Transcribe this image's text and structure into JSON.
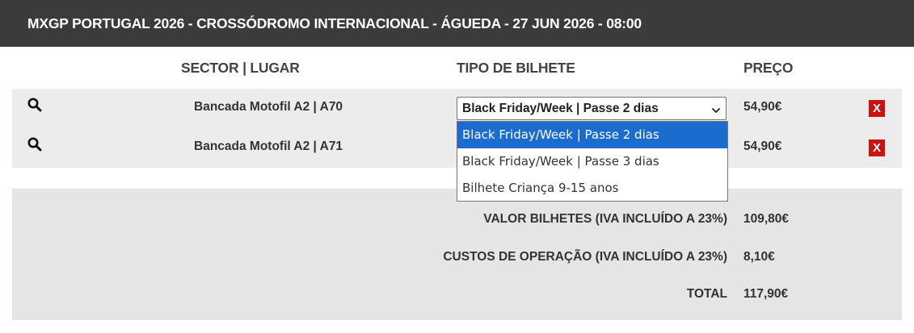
{
  "header": {
    "title": "MXGP PORTUGAL 2026 - CROSSÓDROMO INTERNACIONAL - ÁGUEDA - 27 JUN 2026 - 08:00"
  },
  "columns": {
    "sector": "SECTOR | LUGAR",
    "ticket_type": "TIPO DE BILHETE",
    "price": "PREÇO"
  },
  "rows": [
    {
      "seat": "Bancada Motofil A2 | A70",
      "ticket_type": "Black Friday/Week | Passe 2 dias",
      "price": "54,90€",
      "delete": "X"
    },
    {
      "seat": "Bancada Motofil A2 | A71",
      "ticket_type": "Black Friday/Week | Passe 2 dias",
      "price": "54,90€",
      "delete": "X"
    }
  ],
  "dropdown": {
    "options": [
      "Black Friday/Week | Passe 2 dias",
      "Black Friday/Week | Passe 3 dias",
      "Bilhete Criança 9-15 anos"
    ],
    "selected_index": 0
  },
  "summary": {
    "tickets_label": "VALOR BILHETES (IVA INCLUÍDO A 23%)",
    "tickets_value": "109,80€",
    "fees_label": "CUSTOS DE OPERAÇÃO (IVA INCLUÍDO A 23%)",
    "fees_value": "8,10€",
    "total_label": "TOTAL",
    "total_value": "117,90€"
  },
  "colors": {
    "header_bg": "#3b3b3b",
    "delete_red": "#cc1111",
    "selected_option": "#1a6ccf",
    "row_bg": "#ececec",
    "summary_bg": "#e5e5e5"
  },
  "icons": {
    "search": "magnifier-icon",
    "chevron": "chevron-down-icon"
  }
}
